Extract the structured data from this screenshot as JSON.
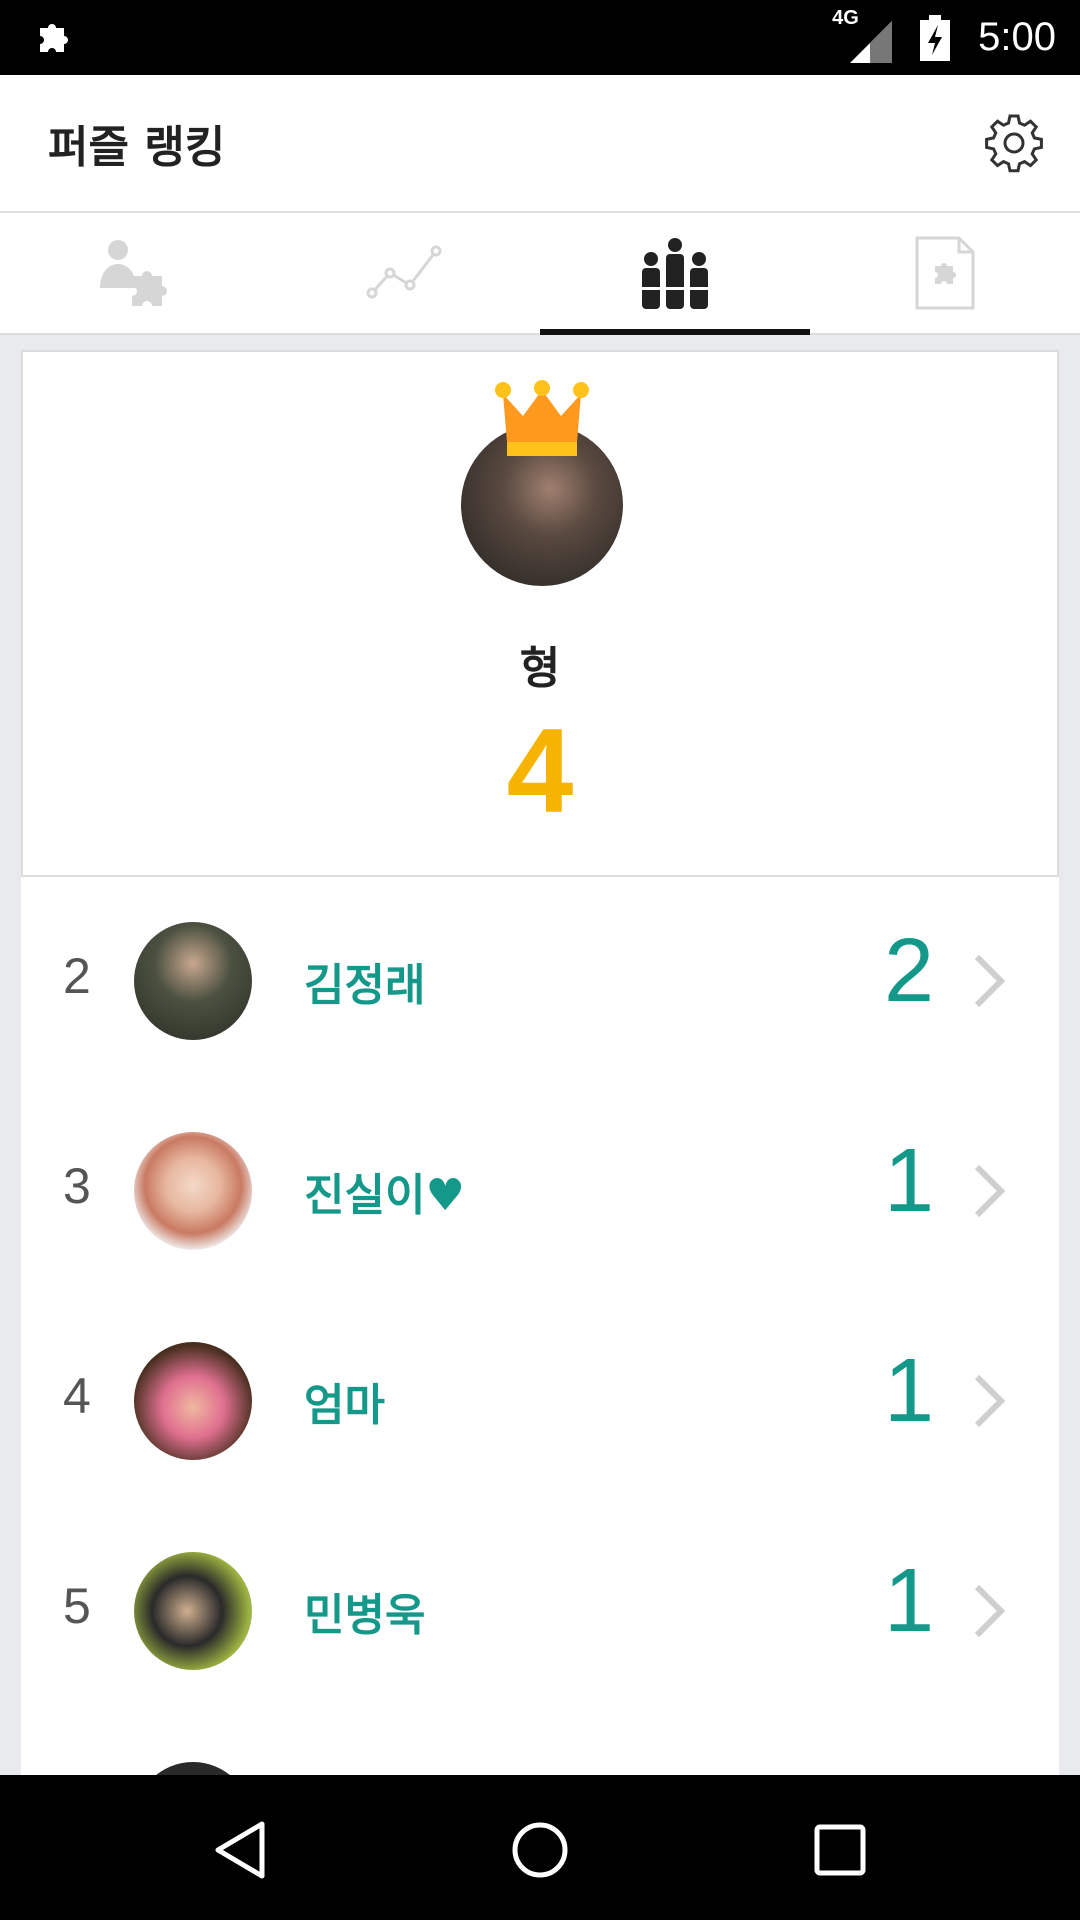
{
  "status_bar": {
    "network": "4G",
    "time": "5:00"
  },
  "app_bar": {
    "title": "퍼즐 랭킹"
  },
  "tabs": [
    {
      "icon": "person-puzzle-icon",
      "active": false
    },
    {
      "icon": "line-chart-icon",
      "active": false
    },
    {
      "icon": "ranking-people-icon",
      "active": true
    },
    {
      "icon": "puzzle-document-icon",
      "active": false
    }
  ],
  "top_ranker": {
    "name": "형",
    "score": "4"
  },
  "ranking": [
    {
      "rank": "2",
      "name": "김정래",
      "score": "2"
    },
    {
      "rank": "3",
      "name": "진실이♥",
      "score": "1"
    },
    {
      "rank": "4",
      "name": "엄마",
      "score": "1"
    },
    {
      "rank": "5",
      "name": "민병욱",
      "score": "1"
    }
  ],
  "colors": {
    "accent": "#14988a",
    "gold": "#f6b400"
  }
}
